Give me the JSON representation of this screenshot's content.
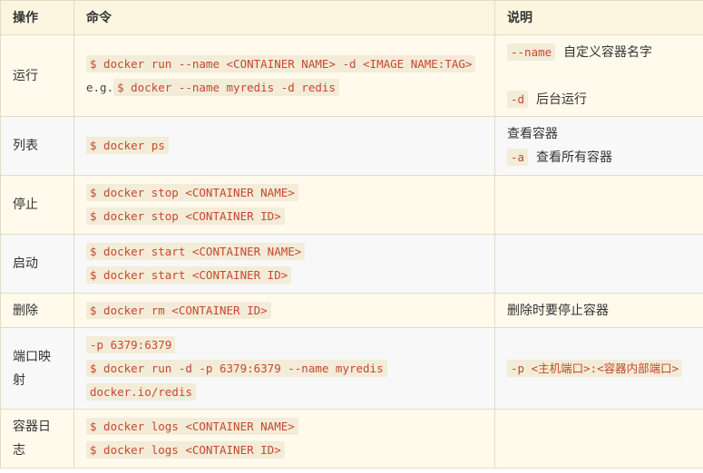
{
  "header": {
    "op": "操作",
    "cmd": "命令",
    "desc": "说明"
  },
  "rows": [
    {
      "op": "运行",
      "cmd": [
        "$ docker run --name <CONTAINER NAME> -d <IMAGE NAME:TAG>"
      ],
      "eg_prefix": "e.g.",
      "eg_cmd": "$ docker --name myredis -d redis",
      "desc": [
        {
          "code": "--name",
          "text": "自定义容器名字"
        },
        {
          "code": "-d",
          "text": "后台运行"
        }
      ]
    },
    {
      "op": "列表",
      "cmd": [
        "$ docker ps"
      ],
      "desc_text": "查看容器",
      "desc": [
        {
          "code": "-a",
          "text": "查看所有容器"
        }
      ]
    },
    {
      "op": "停止",
      "cmd": [
        "$ docker stop <CONTAINER NAME>",
        "$ docker stop <CONTAINER ID>"
      ]
    },
    {
      "op": "启动",
      "cmd": [
        "$ docker start <CONTAINER NAME>",
        "$ docker start <CONTAINER ID>"
      ]
    },
    {
      "op": "删除",
      "cmd": [
        "$ docker rm <CONTAINER ID>"
      ],
      "desc_text": "删除时要停止容器"
    },
    {
      "op": "端口映射",
      "cmd": [
        "-p 6379:6379",
        "$ docker run -d -p 6379:6379 --name myredis docker.io/redis"
      ],
      "desc_code": "-p <主机端口>:<容器内部端口>"
    },
    {
      "op": "容器日志",
      "cmd": [
        "$ docker logs <CONTAINER NAME>",
        "$ docker logs <CONTAINER ID>"
      ]
    }
  ]
}
